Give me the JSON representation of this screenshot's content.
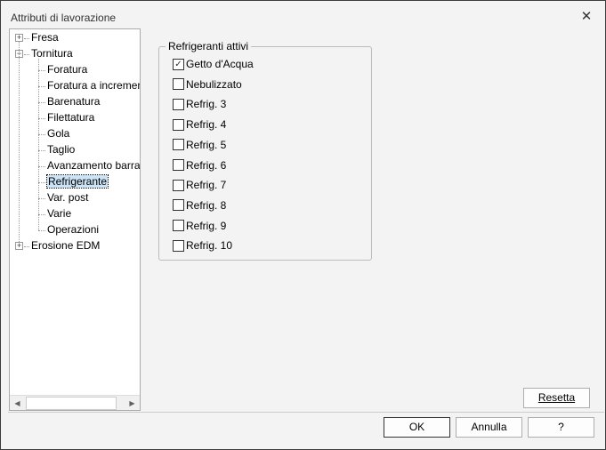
{
  "window": {
    "title": "Attributi di lavorazione",
    "close_icon": "close-icon"
  },
  "tree": {
    "roots": [
      {
        "label": "Fresa",
        "expanded": false
      },
      {
        "label": "Tornitura",
        "expanded": true,
        "children": [
          "Foratura",
          "Foratura a incremen",
          "Barenatura",
          "Filettatura",
          "Gola",
          "Taglio",
          "Avanzamento barra",
          "Refrigerante",
          "Var. post",
          "Varie",
          "Operazioni"
        ]
      },
      {
        "label": "Erosione EDM",
        "expanded": false
      }
    ],
    "selected": "Refrigerante"
  },
  "group": {
    "label": "Refrigeranti attivi",
    "items": [
      {
        "label": "Getto d'Acqua",
        "checked": true
      },
      {
        "label": "Nebulizzato",
        "checked": false
      },
      {
        "label": "Refrig. 3",
        "checked": false
      },
      {
        "label": "Refrig. 4",
        "checked": false
      },
      {
        "label": "Refrig. 5",
        "checked": false
      },
      {
        "label": "Refrig. 6",
        "checked": false
      },
      {
        "label": "Refrig. 7",
        "checked": false
      },
      {
        "label": "Refrig. 8",
        "checked": false
      },
      {
        "label": "Refrig. 9",
        "checked": false
      },
      {
        "label": "Refrig. 10",
        "checked": false
      }
    ]
  },
  "buttons": {
    "reset": "Resetta",
    "ok": "OK",
    "cancel": "Annulla",
    "help": "?"
  }
}
